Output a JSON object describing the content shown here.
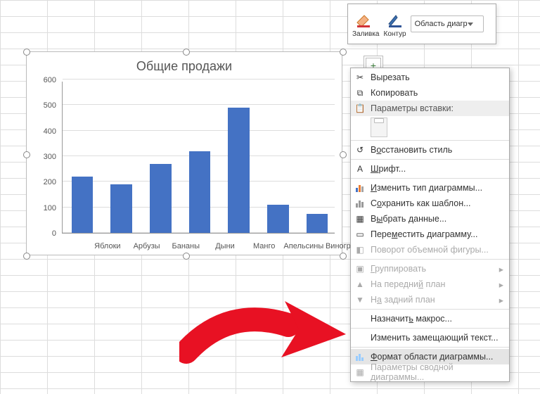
{
  "toolbar": {
    "fill": "Заливка",
    "outline": "Контур",
    "selector": "Область диагр"
  },
  "side_buttons": {
    "plus": "+"
  },
  "menu": {
    "cut": "Вырезать",
    "copy": "Копировать",
    "paste_options": "Параметры вставки:",
    "reset_style": "Восстановить стиль",
    "font": "Шрифт...",
    "change_type": "Изменить тип диаграммы...",
    "save_template": "Сохранить как шаблон...",
    "select_data": "Выбрать данные...",
    "move_chart": "Переместить диаграмму...",
    "rotate3d": "Поворот объемной фигуры...",
    "group": "Группировать",
    "bring_front": "На передний план",
    "send_back": "На задний план",
    "assign_macro": "Назначить макрос...",
    "alt_text": "Изменить замещающий текст...",
    "format_area": "Формат области диаграммы...",
    "pivot_params": "Параметры сводной диаграммы..."
  },
  "chart": {
    "title": "Общие продажи"
  },
  "chart_data": {
    "type": "bar",
    "title": "Общие продажи",
    "xlabel": "",
    "ylabel": "",
    "ylim": [
      0,
      600
    ],
    "yticks": [
      0,
      100,
      200,
      300,
      400,
      500,
      600
    ],
    "categories": [
      "Яблоки",
      "Арбузы",
      "Бананы",
      "Дыни",
      "Манго",
      "Апельсины",
      "Виноград"
    ],
    "values": [
      220,
      190,
      270,
      320,
      490,
      110,
      75
    ]
  }
}
